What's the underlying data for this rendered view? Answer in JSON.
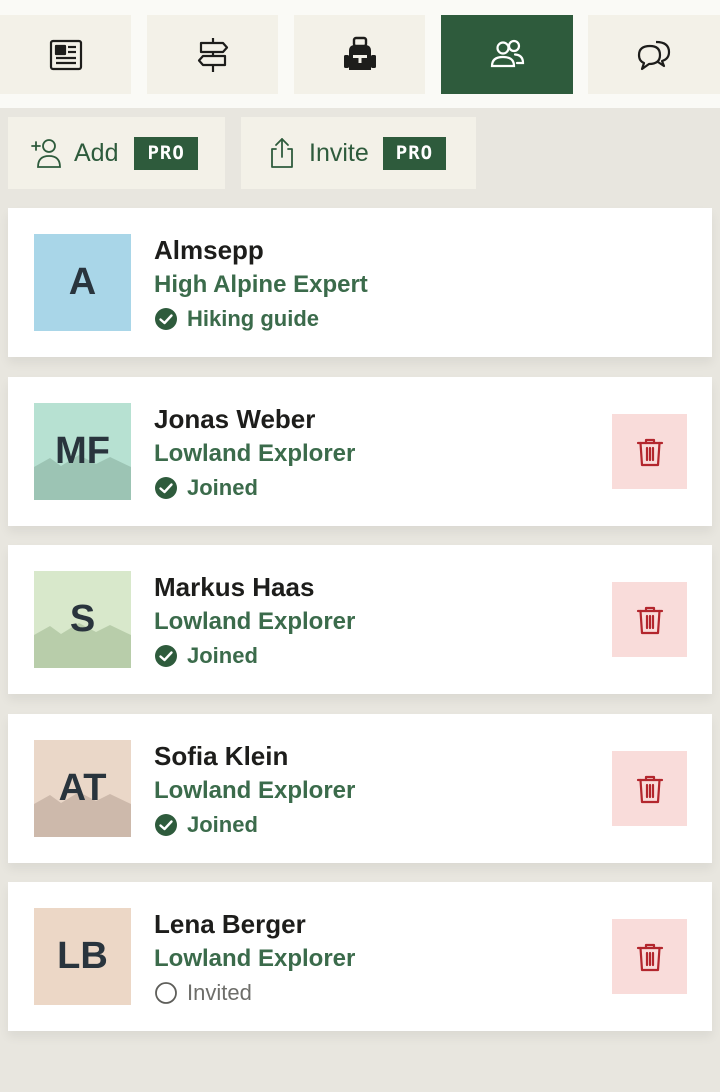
{
  "nav": {
    "tabs": [
      {
        "icon": "newspaper-icon",
        "active": false
      },
      {
        "icon": "signpost-icon",
        "active": false
      },
      {
        "icon": "backpack-icon",
        "active": false
      },
      {
        "icon": "people-icon",
        "active": true
      },
      {
        "icon": "chat-bubbles-icon",
        "active": false
      }
    ]
  },
  "actions": {
    "add": {
      "label": "Add",
      "badge": "PRO",
      "icon": "add-person-icon"
    },
    "invite": {
      "label": "Invite",
      "badge": "PRO",
      "icon": "share-icon"
    }
  },
  "colors": {
    "accent": "#2e5b3c",
    "role_text": "#3b6b4b",
    "danger_bg": "#f9dcda",
    "danger_icon": "#b3262d"
  },
  "members": [
    {
      "initials": "A",
      "name": "Almsepp",
      "role": "High Alpine Expert",
      "status": "Hiking guide",
      "status_type": "checked",
      "avatar_color": "#a9d6e8",
      "mountains": false,
      "deletable": false
    },
    {
      "initials": "MF",
      "name": "Jonas Weber",
      "role": "Lowland Explorer",
      "status": "Joined",
      "status_type": "checked",
      "avatar_color": "#b7e1d2",
      "mountain_color": "#9cc4b4",
      "mountains": true,
      "deletable": true
    },
    {
      "initials": "S",
      "name": "Markus Haas",
      "role": "Lowland Explorer",
      "status": "Joined",
      "status_type": "checked",
      "avatar_color": "#d8e8cb",
      "mountain_color": "#b8cdaa",
      "mountains": true,
      "deletable": true
    },
    {
      "initials": "AT",
      "name": "Sofia Klein",
      "role": "Lowland Explorer",
      "status": "Joined",
      "status_type": "checked",
      "avatar_color": "#ead7c8",
      "mountain_color": "#cdb9ab",
      "mountains": true,
      "deletable": true
    },
    {
      "initials": "LB",
      "name": "Lena Berger",
      "role": "Lowland Explorer",
      "status": "Invited",
      "status_type": "pending",
      "avatar_color": "#ecd7c6",
      "mountains": false,
      "deletable": true
    }
  ]
}
